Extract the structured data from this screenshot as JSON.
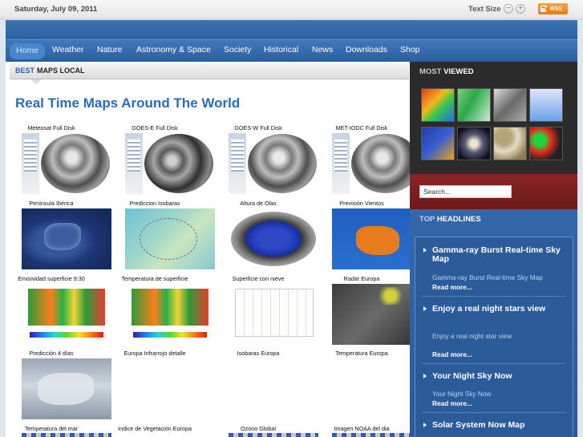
{
  "topbar": {
    "date": "Saturday, July 09, 2011",
    "text_size_label": "Text Size",
    "decrease_glyph": "−",
    "increase_glyph": "+",
    "rss_label": "RSS"
  },
  "nav": {
    "items": [
      "Home",
      "Weather",
      "Nature",
      "Astronomy & Space",
      "Society",
      "Historical",
      "News",
      "Downloads",
      "Shop"
    ]
  },
  "main": {
    "tab": {
      "word1": "BEST",
      "word2": "MAPS LOCAL"
    },
    "title": "Real Time Maps Around The World",
    "maps": [
      {
        "caption": "Meteosat Full Disk",
        "thumb": "satellite-disk"
      },
      {
        "caption": "GOES-E Full Disk",
        "thumb": "satellite-disk"
      },
      {
        "caption": "GOES-W Full Disk",
        "thumb": "satellite-disk"
      },
      {
        "caption": "MET-IODC Full Disk",
        "thumb": "satellite-disk"
      },
      {
        "caption": "Peninsula Ibérica",
        "thumb": "iberia-satellite"
      },
      {
        "caption": "Prediccion Isobaras",
        "thumb": "isobar-forecast"
      },
      {
        "caption": "Altura de Olas",
        "thumb": "wave-height"
      },
      {
        "caption": "Previsión Vientos",
        "thumb": "wind-forecast"
      },
      {
        "caption": "Emisividad superficie 9:30",
        "thumb": "temperature-grid"
      },
      {
        "caption": "Temperatura de superficie",
        "thumb": "temperature-grid"
      },
      {
        "caption": "Superficie con nieve",
        "thumb": "isobar-grid"
      },
      {
        "caption": "Radar Europa",
        "thumb": "radar"
      },
      {
        "caption": "Predicción 4 días",
        "thumb": "europe-forecast"
      },
      {
        "caption": "Europa Infrarrojo detalle",
        "thumb": ""
      },
      {
        "caption": "Isobaras Europa",
        "thumb": ""
      },
      {
        "caption": "Temperatura Europa",
        "thumb": ""
      },
      {
        "caption": "Temperatura del mar",
        "thumb": ""
      },
      {
        "caption": "Indice de Vegetación Europa",
        "thumb": ""
      },
      {
        "caption": "Ozono Global",
        "thumb": ""
      },
      {
        "caption": "Imagen NOAA del dia",
        "thumb": ""
      }
    ]
  },
  "sidebar": {
    "most_viewed": {
      "word1": "MOST",
      "word2": "VIEWED"
    },
    "search_placeholder": "Search...",
    "top_headlines": {
      "word1": "TOP",
      "word2": "HEADLINES",
      "items": [
        {
          "title": "Gamma-ray Burst Real-time Sky Map",
          "desc": "Gamma-ray Burst Real-time Sky Map",
          "more": "Read more..."
        },
        {
          "title": "Enjoy a real night stars view",
          "desc": "Enjoy a real night star view",
          "more": "Read more..."
        },
        {
          "title": "Your Night Sky Now",
          "desc": "Your Night Sky Now",
          "more": "Read more..."
        },
        {
          "title": "Solar System Now Map",
          "desc": "",
          "more": ""
        }
      ]
    }
  },
  "colors": {
    "nav_blue": "#3a72b4",
    "title_blue": "#2a6cb8",
    "search_band": "#7a1e1e",
    "rss_orange": "#f08a1f"
  }
}
